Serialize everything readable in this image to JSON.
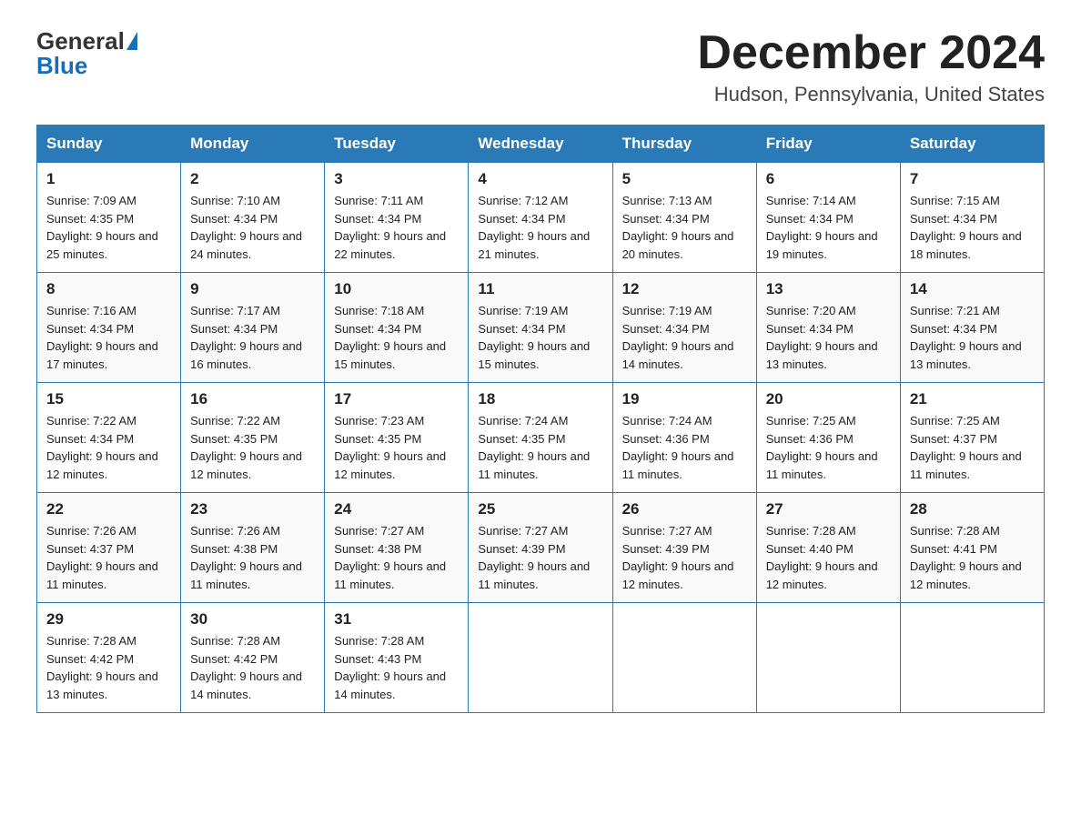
{
  "header": {
    "logo_general": "General",
    "logo_blue": "Blue",
    "month_title": "December 2024",
    "location": "Hudson, Pennsylvania, United States"
  },
  "weekdays": [
    "Sunday",
    "Monday",
    "Tuesday",
    "Wednesday",
    "Thursday",
    "Friday",
    "Saturday"
  ],
  "weeks": [
    [
      {
        "day": "1",
        "sunrise": "Sunrise: 7:09 AM",
        "sunset": "Sunset: 4:35 PM",
        "daylight": "Daylight: 9 hours and 25 minutes."
      },
      {
        "day": "2",
        "sunrise": "Sunrise: 7:10 AM",
        "sunset": "Sunset: 4:34 PM",
        "daylight": "Daylight: 9 hours and 24 minutes."
      },
      {
        "day": "3",
        "sunrise": "Sunrise: 7:11 AM",
        "sunset": "Sunset: 4:34 PM",
        "daylight": "Daylight: 9 hours and 22 minutes."
      },
      {
        "day": "4",
        "sunrise": "Sunrise: 7:12 AM",
        "sunset": "Sunset: 4:34 PM",
        "daylight": "Daylight: 9 hours and 21 minutes."
      },
      {
        "day": "5",
        "sunrise": "Sunrise: 7:13 AM",
        "sunset": "Sunset: 4:34 PM",
        "daylight": "Daylight: 9 hours and 20 minutes."
      },
      {
        "day": "6",
        "sunrise": "Sunrise: 7:14 AM",
        "sunset": "Sunset: 4:34 PM",
        "daylight": "Daylight: 9 hours and 19 minutes."
      },
      {
        "day": "7",
        "sunrise": "Sunrise: 7:15 AM",
        "sunset": "Sunset: 4:34 PM",
        "daylight": "Daylight: 9 hours and 18 minutes."
      }
    ],
    [
      {
        "day": "8",
        "sunrise": "Sunrise: 7:16 AM",
        "sunset": "Sunset: 4:34 PM",
        "daylight": "Daylight: 9 hours and 17 minutes."
      },
      {
        "day": "9",
        "sunrise": "Sunrise: 7:17 AM",
        "sunset": "Sunset: 4:34 PM",
        "daylight": "Daylight: 9 hours and 16 minutes."
      },
      {
        "day": "10",
        "sunrise": "Sunrise: 7:18 AM",
        "sunset": "Sunset: 4:34 PM",
        "daylight": "Daylight: 9 hours and 15 minutes."
      },
      {
        "day": "11",
        "sunrise": "Sunrise: 7:19 AM",
        "sunset": "Sunset: 4:34 PM",
        "daylight": "Daylight: 9 hours and 15 minutes."
      },
      {
        "day": "12",
        "sunrise": "Sunrise: 7:19 AM",
        "sunset": "Sunset: 4:34 PM",
        "daylight": "Daylight: 9 hours and 14 minutes."
      },
      {
        "day": "13",
        "sunrise": "Sunrise: 7:20 AM",
        "sunset": "Sunset: 4:34 PM",
        "daylight": "Daylight: 9 hours and 13 minutes."
      },
      {
        "day": "14",
        "sunrise": "Sunrise: 7:21 AM",
        "sunset": "Sunset: 4:34 PM",
        "daylight": "Daylight: 9 hours and 13 minutes."
      }
    ],
    [
      {
        "day": "15",
        "sunrise": "Sunrise: 7:22 AM",
        "sunset": "Sunset: 4:34 PM",
        "daylight": "Daylight: 9 hours and 12 minutes."
      },
      {
        "day": "16",
        "sunrise": "Sunrise: 7:22 AM",
        "sunset": "Sunset: 4:35 PM",
        "daylight": "Daylight: 9 hours and 12 minutes."
      },
      {
        "day": "17",
        "sunrise": "Sunrise: 7:23 AM",
        "sunset": "Sunset: 4:35 PM",
        "daylight": "Daylight: 9 hours and 12 minutes."
      },
      {
        "day": "18",
        "sunrise": "Sunrise: 7:24 AM",
        "sunset": "Sunset: 4:35 PM",
        "daylight": "Daylight: 9 hours and 11 minutes."
      },
      {
        "day": "19",
        "sunrise": "Sunrise: 7:24 AM",
        "sunset": "Sunset: 4:36 PM",
        "daylight": "Daylight: 9 hours and 11 minutes."
      },
      {
        "day": "20",
        "sunrise": "Sunrise: 7:25 AM",
        "sunset": "Sunset: 4:36 PM",
        "daylight": "Daylight: 9 hours and 11 minutes."
      },
      {
        "day": "21",
        "sunrise": "Sunrise: 7:25 AM",
        "sunset": "Sunset: 4:37 PM",
        "daylight": "Daylight: 9 hours and 11 minutes."
      }
    ],
    [
      {
        "day": "22",
        "sunrise": "Sunrise: 7:26 AM",
        "sunset": "Sunset: 4:37 PM",
        "daylight": "Daylight: 9 hours and 11 minutes."
      },
      {
        "day": "23",
        "sunrise": "Sunrise: 7:26 AM",
        "sunset": "Sunset: 4:38 PM",
        "daylight": "Daylight: 9 hours and 11 minutes."
      },
      {
        "day": "24",
        "sunrise": "Sunrise: 7:27 AM",
        "sunset": "Sunset: 4:38 PM",
        "daylight": "Daylight: 9 hours and 11 minutes."
      },
      {
        "day": "25",
        "sunrise": "Sunrise: 7:27 AM",
        "sunset": "Sunset: 4:39 PM",
        "daylight": "Daylight: 9 hours and 11 minutes."
      },
      {
        "day": "26",
        "sunrise": "Sunrise: 7:27 AM",
        "sunset": "Sunset: 4:39 PM",
        "daylight": "Daylight: 9 hours and 12 minutes."
      },
      {
        "day": "27",
        "sunrise": "Sunrise: 7:28 AM",
        "sunset": "Sunset: 4:40 PM",
        "daylight": "Daylight: 9 hours and 12 minutes."
      },
      {
        "day": "28",
        "sunrise": "Sunrise: 7:28 AM",
        "sunset": "Sunset: 4:41 PM",
        "daylight": "Daylight: 9 hours and 12 minutes."
      }
    ],
    [
      {
        "day": "29",
        "sunrise": "Sunrise: 7:28 AM",
        "sunset": "Sunset: 4:42 PM",
        "daylight": "Daylight: 9 hours and 13 minutes."
      },
      {
        "day": "30",
        "sunrise": "Sunrise: 7:28 AM",
        "sunset": "Sunset: 4:42 PM",
        "daylight": "Daylight: 9 hours and 14 minutes."
      },
      {
        "day": "31",
        "sunrise": "Sunrise: 7:28 AM",
        "sunset": "Sunset: 4:43 PM",
        "daylight": "Daylight: 9 hours and 14 minutes."
      },
      null,
      null,
      null,
      null
    ]
  ]
}
